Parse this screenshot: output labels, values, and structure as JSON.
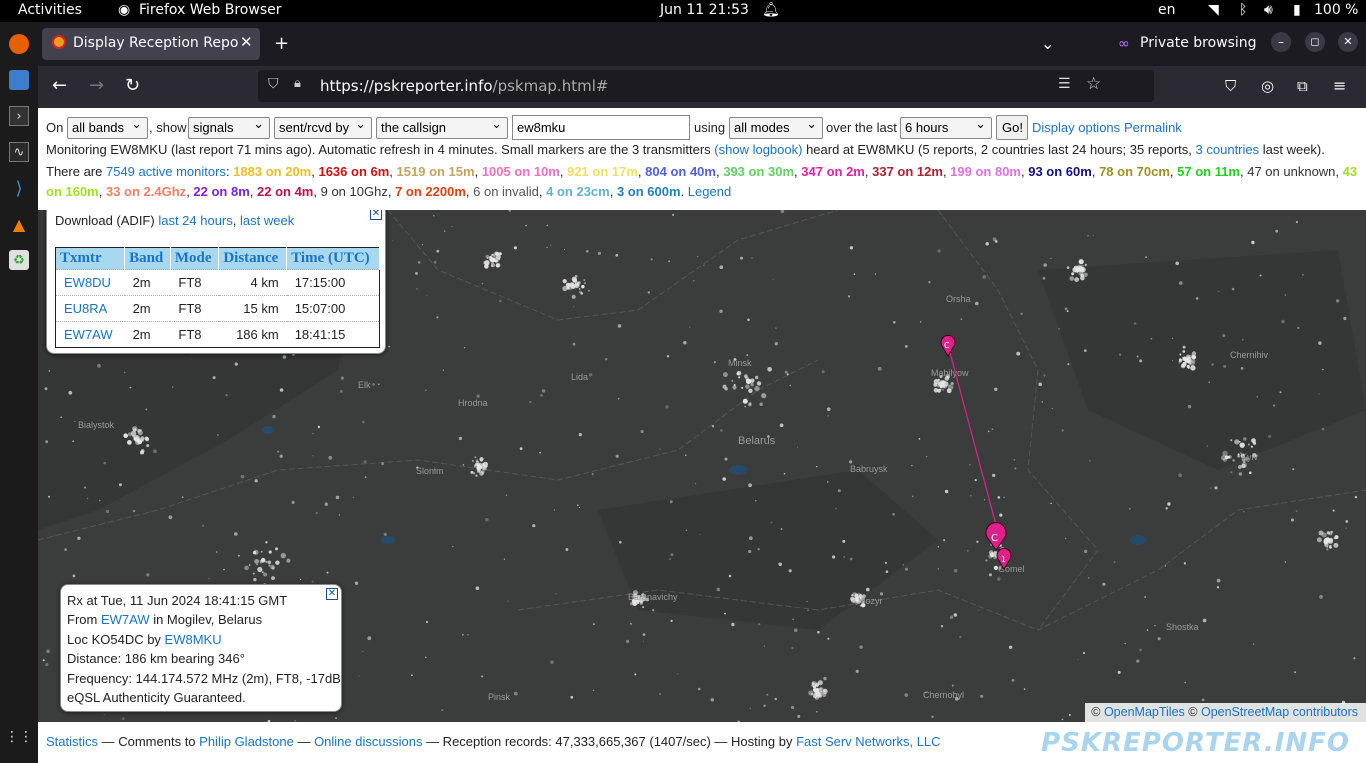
{
  "topbar": {
    "activities": "Activities",
    "app": "Firefox Web Browser",
    "datetime": "Jun 11  21:53",
    "lang": "en",
    "battery": "100 %"
  },
  "browser": {
    "tab_title": "Display Reception Report",
    "private": "Private browsing",
    "url_host": "https://pskreporter.info",
    "url_path": "/pskmap.html#"
  },
  "controls": {
    "on": "On",
    "bands": "all bands",
    "show": ", show",
    "signals": "signals",
    "sent": "sent/rcvd by",
    "callsign_mode": "the callsign",
    "callsign_value": "ew8mku",
    "using": "using",
    "modes": "all modes",
    "over": "over the last",
    "period": "6 hours",
    "go": "Go!",
    "display_options": "Display options",
    "permalink": "Permalink"
  },
  "monitoring": {
    "text1": "Monitoring EW8MKU (last report 71 mins ago). Automatic refresh in 4 minutes. Small markers are the 3 transmitters ",
    "show_logbook": "(show logbook)",
    "text2": " heard at EW8MKU (5 reports, 2 countries last 24 hours; 35 reports, ",
    "countries": "3 countries",
    "text3": " last week)."
  },
  "monitors": {
    "prefix": "There are ",
    "active": "7549 active monitors",
    "colon": ":",
    "legend": "Legend",
    "bands": [
      {
        "t": "1883 on 20m",
        "c": "#e8c020"
      },
      {
        "t": "1636 on 6m",
        "c": "#d01010"
      },
      {
        "t": "1519 on 15m",
        "c": "#c8a060"
      },
      {
        "t": "1005 on 10m",
        "c": "#f070c0"
      },
      {
        "t": "921 on 17m",
        "c": "#f0e060"
      },
      {
        "t": "804 on 40m",
        "c": "#5060e0"
      },
      {
        "t": "393 on 30m",
        "c": "#60d060"
      },
      {
        "t": "347 on 2m",
        "c": "#e020a0"
      },
      {
        "t": "337 on 12m",
        "c": "#b02030"
      },
      {
        "t": "199 on 80m",
        "c": "#e070e0"
      },
      {
        "t": "93 on 60m",
        "c": "#101080"
      },
      {
        "t": "78 on 70cm",
        "c": "#a09020"
      },
      {
        "t": "57 on 11m",
        "c": "#20d020"
      },
      {
        "t": "47 on unknown",
        "c": "#333333",
        "plain": true
      },
      {
        "t": "43 on 160m",
        "c": "#a0e020"
      },
      {
        "t": "33 on 2.4Ghz",
        "c": "#f08060"
      },
      {
        "t": "22 on 8m",
        "c": "#8020e0"
      },
      {
        "t": "22 on 4m",
        "c": "#c01050"
      },
      {
        "t": "9 on 10Ghz",
        "c": "#333333",
        "plain": true
      },
      {
        "t": "7 on 2200m",
        "c": "#e04010"
      },
      {
        "t": "6 on invalid",
        "c": "#555555",
        "plain": true
      },
      {
        "t": "4 on 23cm",
        "c": "#60b0d0"
      },
      {
        "t": "3 on 600m",
        "c": "#2080c0"
      }
    ]
  },
  "download": {
    "label": "Download (ADIF)",
    "last24": "last 24 hours",
    "lastweek": "last week",
    "headers": [
      "Txmtr",
      "Band",
      "Mode",
      "Distance",
      "Time (UTC)"
    ],
    "rows": [
      [
        "EW8DU",
        "2m",
        "FT8",
        "4 km",
        "17:15:00"
      ],
      [
        "EU8RA",
        "2m",
        "FT8",
        "15 km",
        "15:07:00"
      ],
      [
        "EW7AW",
        "2m",
        "FT8",
        "186 km",
        "18:41:15"
      ]
    ]
  },
  "info": {
    "rx": "Rx at Tue, 11 Jun 2024 18:41:15 GMT",
    "from_pre": "From ",
    "from_call": "EW7AW",
    "from_post": " in Mogilev, Belarus",
    "loc_pre": "Loc KO54DC by ",
    "loc_call": "EW8MKU",
    "distance": "Distance: 186 km bearing 346°",
    "freq": "Frequency: 144.174.572 MHz (2m), FT8, -17dB",
    "eqsl": "eQSL Authenticity Guaranteed."
  },
  "map": {
    "labels": [
      "Belarus",
      "Minsk",
      "Orsha",
      "Mahilyow",
      "Babruysk",
      "Gomel",
      "Mozyr",
      "Lida",
      "Hrodna",
      "Slonim",
      "Baranavichy",
      "Pinsk",
      "Kyiv",
      "Chernihiv",
      "Shostka",
      "Chernobyl",
      "Elk",
      "Bialystok"
    ],
    "attrib_osm_tiles": "OpenMapTiles",
    "attrib_osm": "OpenStreetMap contributors",
    "attrib_c": "©"
  },
  "footer": {
    "statistics": "Statistics",
    "comments": " — Comments to ",
    "pg": "Philip Gladstone",
    "dash1": " — ",
    "online": "Online discussions",
    "records": " — Reception records: 47,333,665,367 (1407/sec) — Hosting by ",
    "fast": "Fast Serv Networks, LLC",
    "logo": "PSKREPORTER.INFO"
  }
}
